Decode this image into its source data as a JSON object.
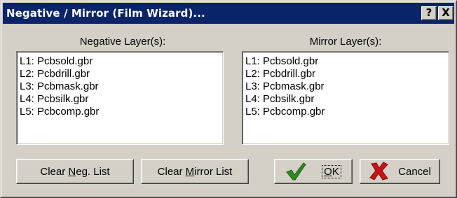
{
  "window": {
    "title": "Negative / Mirror (Film Wizard)...",
    "help_glyph": "?",
    "close_glyph": "X"
  },
  "negative": {
    "label": "Negative Layer(s):",
    "items": [
      "L1: Pcbsold.gbr",
      "L2: Pcbdrill.gbr",
      "L3: Pcbmask.gbr",
      "L4: Pcbsilk.gbr",
      "L5: Pcbcomp.gbr"
    ]
  },
  "mirror": {
    "label": "Mirror Layer(s):",
    "items": [
      "L1: Pcbsold.gbr",
      "L2: Pcbdrill.gbr",
      "L3: Pcbmask.gbr",
      "L4: Pcbsilk.gbr",
      "L5: Pcbcomp.gbr"
    ]
  },
  "buttons": {
    "clear_neg": {
      "pre": "Clear ",
      "mnemonic": "N",
      "post": "eg. List"
    },
    "clear_mirror": {
      "pre": "Clear ",
      "mnemonic": "M",
      "post": "irror List"
    },
    "ok": {
      "mnemonic": "O",
      "post": "K"
    },
    "cancel": "Cancel"
  },
  "colors": {
    "titlebar": "#0a246a",
    "face": "#d4d0c8",
    "check_icon": "#2e8b1e",
    "x_icon": "#c81414"
  },
  "icons": {
    "ok": "checkmark-icon",
    "cancel": "x-icon"
  }
}
